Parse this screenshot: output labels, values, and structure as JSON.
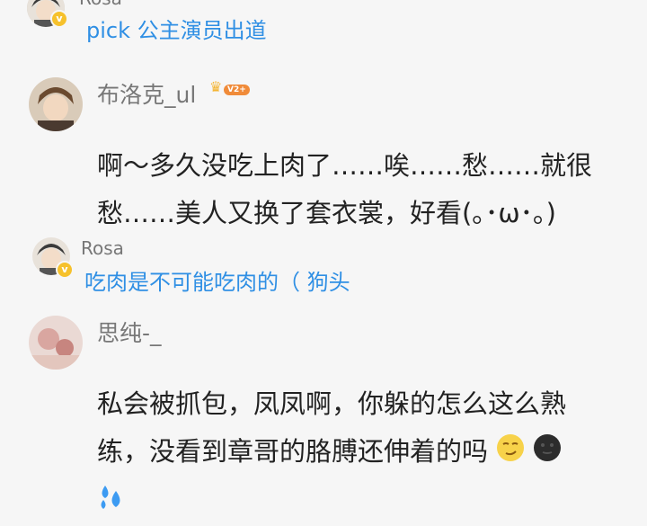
{
  "comments": [
    {
      "reply": {
        "user": "Rosa",
        "text": "pick 公主演员出道"
      }
    },
    {
      "user": "布洛克_ul",
      "level_badge": "V2+",
      "lines": [
        "啊～多久没吃上肉了……唉……愁……就很",
        "愁……美人又换了套衣裳，好看(｡･ω･｡)"
      ],
      "reply": {
        "user": "Rosa",
        "text": "吃肉是不可能吃肉的（ 狗头"
      }
    },
    {
      "user": "思纯-_",
      "lines": [
        "私会被抓包，凤凤啊，你躲的怎么这么熟",
        "练，没看到章哥的胳膊还伸着的吗"
      ],
      "emojis": [
        "smirk-face-emoji",
        "dark-moon-face-emoji",
        "sweat-droplets-emoji"
      ]
    }
  ],
  "colors": {
    "background": "#f6f6f6",
    "reply_name": "#777777",
    "reply_text": "#2f8fe4",
    "body_text": "#222222",
    "verified": "#f6c12c"
  }
}
